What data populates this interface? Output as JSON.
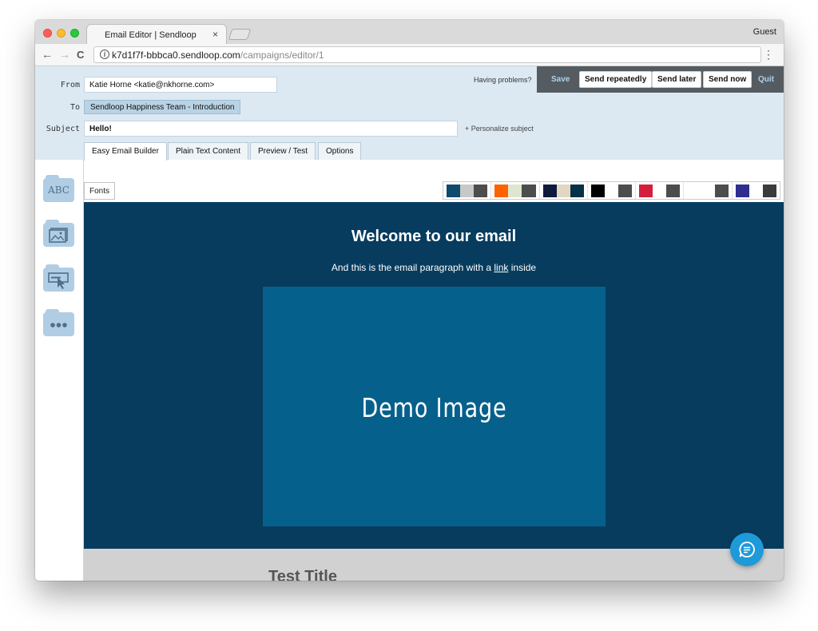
{
  "browser": {
    "tab_title": "Email Editor | Sendloop",
    "tab_close": "×",
    "profile": "Guest",
    "url_host": "k7d1f7f-bbbca0.sendloop.com",
    "url_path": "/campaigns/editor/1",
    "back": "←",
    "forward": "→",
    "reload": "C",
    "menu": "⋮"
  },
  "header": {
    "from_label": "From",
    "from_value": "Katie Horne <katie@nkhorne.com>",
    "to_label": "To",
    "to_value": "Sendloop Happiness Team - Introduction",
    "subject_label": "Subject",
    "subject_value": "Hello!",
    "personalize": "+ Personalize subject",
    "problems": "Having problems?"
  },
  "actions": {
    "save": "Save",
    "send_repeatedly": "Send repeatedly",
    "send_later": "Send later",
    "send_now": "Send now",
    "quit": "Quit"
  },
  "tabs": [
    {
      "label": "Easy Email Builder"
    },
    {
      "label": "Plain Text Content"
    },
    {
      "label": "Preview / Test"
    },
    {
      "label": "Options"
    }
  ],
  "sidebar": {
    "text_tool": "ABC"
  },
  "fonts_button": "Fonts",
  "color_themes": [
    [
      "#0d4a6e",
      "#c8c8c8",
      "#4d4d4d"
    ],
    [
      "#ff6200",
      "#dfe6cf",
      "#4d4d4d"
    ],
    [
      "#0e1b3b",
      "#e3d7c2",
      "#063147"
    ],
    [
      "#000000",
      "#ffffff",
      "#4d4d4d"
    ],
    [
      "#d21f3c",
      "#ffffff",
      "#4d4d4d"
    ],
    [
      "#ffffff",
      "#ffffff",
      "#4d4d4d"
    ],
    [
      "#2e2f8f",
      "#ffffff",
      "#3b3b3b"
    ]
  ],
  "canvas": {
    "heading": "Welcome to our email",
    "para_before": "And this is the email paragraph with a ",
    "para_link": "link",
    "para_after": " inside",
    "image_label": "Demo Image",
    "test_title": "Test Title"
  }
}
